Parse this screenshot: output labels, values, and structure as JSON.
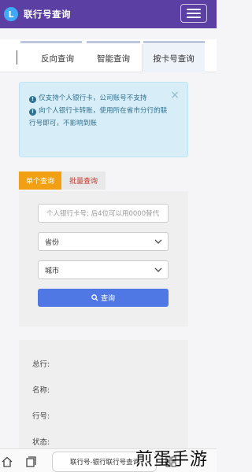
{
  "header": {
    "logo_letter": "L",
    "title": "联行号查询",
    "menu_icon": "hamburger-icon"
  },
  "tabs": [
    {
      "label": "反向查询"
    },
    {
      "label": "智能查询"
    },
    {
      "label": "按卡号查询",
      "active": true
    }
  ],
  "alert": {
    "close": "×",
    "line1": "仅支持个人银行卡，公司账号不支持",
    "line2": "向个人银行卡转账，使用所在省市分行的联行号即可，不影响到账"
  },
  "subtabs": {
    "single": "单个查询",
    "batch": "批量查询"
  },
  "form": {
    "card_placeholder": "个人银行卡号; 后4位可以用0000替代",
    "province": "省份",
    "city": "城市",
    "search_label": "查询"
  },
  "results": {
    "head_office": "总行:",
    "name": "名称:",
    "code": "行号:",
    "status": "状态:"
  },
  "browser": {
    "url_text": "联行号-银行联行号查询"
  },
  "watermark": "煎蛋手游",
  "colors": {
    "header": "#5b3fa3",
    "active_subtab": "#f0a012",
    "button": "#4f78e4",
    "alert_bg": "#d7eef8"
  }
}
